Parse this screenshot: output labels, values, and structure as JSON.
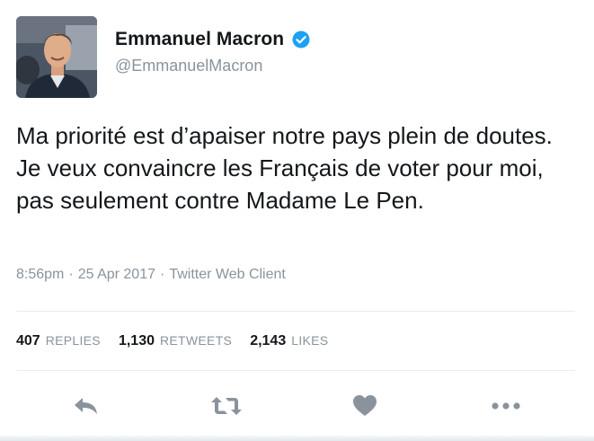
{
  "tweet": {
    "display_name": "Emmanuel Macron",
    "handle": "@EmmanuelMacron",
    "text": "Ma priorité est d’apaiser notre pays plein de doutes. Je veux convaincre les Français de voter pour moi, pas seulement contre Madame Le Pen.",
    "time": "8:56pm",
    "date": "25 Apr 2017",
    "client": "Twitter Web Client",
    "separator": "·",
    "verified": true
  },
  "stats": {
    "replies_count": "407",
    "replies_label": "REPLIES",
    "retweets_count": "1,130",
    "retweets_label": "RETWEETS",
    "likes_count": "2,143",
    "likes_label": "LIKES"
  },
  "actions": [
    {
      "name": "reply",
      "icon": "reply-icon"
    },
    {
      "name": "retweet",
      "icon": "retweet-icon"
    },
    {
      "name": "like",
      "icon": "heart-icon"
    },
    {
      "name": "more",
      "icon": "more-icon"
    }
  ],
  "colors": {
    "verified_blue": "#1da1f2",
    "action_gray": "#8a939c",
    "text": "#14171a",
    "muted": "#8a939c"
  }
}
